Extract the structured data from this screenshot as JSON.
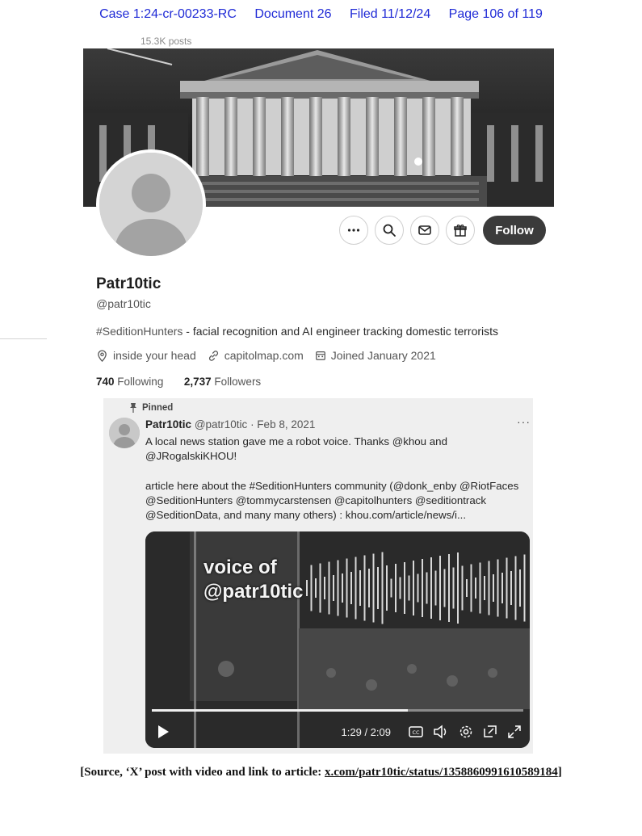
{
  "case_header": {
    "case": "Case 1:24-cr-00233-RC",
    "document": "Document 26",
    "filed": "Filed 11/12/24",
    "page": "Page 106 of 119"
  },
  "profile": {
    "posts_count": "15.3K posts",
    "display_name": "Patr10tic",
    "handle": "@patr10tic",
    "bio_hashtag": "#SeditionHunters",
    "bio_rest": " - facial recognition and AI engineer tracking domestic terrorists",
    "location": "inside your head",
    "website": "capitolmap.com",
    "joined": "Joined January 2021",
    "following_count": "740",
    "following_label": "Following",
    "followers_count": "2,737",
    "followers_label": "Followers",
    "follow_button": "Follow",
    "action_icons": [
      "more-icon",
      "search-icon",
      "mail-icon",
      "gift-icon"
    ]
  },
  "pinned_tweet": {
    "pinned_label": "Pinned",
    "author_name": "Patr10tic",
    "author_handle": "@patr10tic",
    "date": "· Feb 8, 2021",
    "more": "···",
    "lines": [
      "A local news station gave me a robot voice. Thanks @khou and",
      "@JRogalskiKHOU!",
      "",
      "article here about the #SeditionHunters community (@donk_enby @RiotFaces",
      "@SeditionHunters @tommycarstensen @capitolhunters @seditiontrack",
      "@SeditionData, and many many others) : khou.com/article/news/i..."
    ],
    "video": {
      "caption_line1": "voice of",
      "caption_line2": "@patr10tic",
      "time": "1:29 / 2:09",
      "progress": 0.69,
      "controls": [
        "play-icon",
        "captions-icon",
        "volume-icon",
        "settings-icon",
        "pip-icon",
        "fullscreen-icon"
      ]
    }
  },
  "source": {
    "prefix": "[Source, ‘X’ post with video and link to article: ",
    "link": "x.com/patr10tic/status/1358860991610589184",
    "suffix": "]"
  }
}
